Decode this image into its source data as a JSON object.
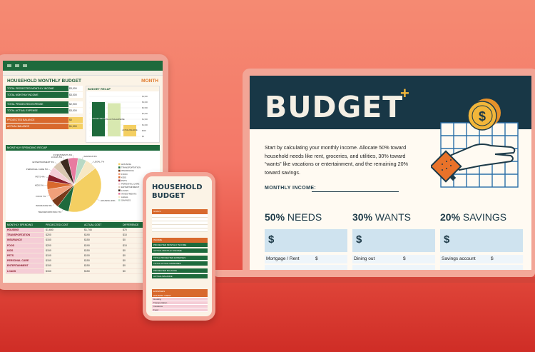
{
  "tablet": {
    "sheet_title": "HOUSEHOLD MONTHLY BUDGET",
    "sheet_month": "MONTH",
    "income_rows": [
      {
        "label": "TOTAL PROJECTED MONTHLY INCOME",
        "value": "$3,000",
        "style": "green",
        "val": "white"
      },
      {
        "label": "TOTAL MONTHLY INCOME",
        "value": "$3,000",
        "style": "green",
        "val": "white"
      },
      {
        "label": "TOTAL PROJECTED EXPENSE",
        "value": "$2,900",
        "style": "green",
        "val": "white",
        "gap": true
      },
      {
        "label": "TOTAL ACTUAL EXPENSE",
        "value": "$3,000",
        "style": "green",
        "val": "white"
      },
      {
        "label": "PROJECTED BALANCE",
        "value": "$0",
        "style": "orange",
        "val": "yellow",
        "gap": true
      },
      {
        "label": "ACTUAL BALANCE",
        "value": "$1,000",
        "style": "orange",
        "val": "yellow"
      }
    ],
    "recap_title": "BUDGET RECAP",
    "recap_bars": [
      {
        "label": "TOTAL PROJECTED INCOME",
        "value": 3000,
        "color": "#1e6a3c"
      },
      {
        "label": "TOTAL ACTUAL EXPENSE",
        "value": 2900,
        "color": "#d8e8b0"
      },
      {
        "label": "ACTUAL BALANCE",
        "value": 1000,
        "color": "#f4cf62"
      }
    ],
    "recap_yticks": [
      "$3,500",
      "$3,000",
      "$2,500",
      "$2,000",
      "$1,500",
      "$1,000",
      "$500",
      "$0"
    ],
    "spend_title": "MONTHLY SPENDING RECAP",
    "pie_slices": [
      {
        "label": "HOUSING 39%",
        "value": 39,
        "color": "#f4cf62"
      },
      {
        "label": "TRANSPORTATION 7%",
        "value": 7,
        "color": "#1e6a3c"
      },
      {
        "label": "INSURANCE 5%",
        "value": 5,
        "color": "#7a3a1a"
      },
      {
        "label": "FOOD 7%",
        "value": 7,
        "color": "#f1a07a"
      },
      {
        "label": "KIDS 5%",
        "value": 5,
        "color": "#d8692d"
      },
      {
        "label": "PETS 4%",
        "value": 4,
        "color": "#8a1f2c"
      },
      {
        "label": "PERSONAL CARE 5%",
        "value": 5,
        "color": "#f5cdd6"
      },
      {
        "label": "ENTERTAINMENT 5%",
        "value": 5,
        "color": "#d9c6b0"
      },
      {
        "label": "LOANS 5%",
        "value": 5,
        "color": "#3d2a20"
      },
      {
        "label": "INVESTMENTS 6%",
        "value": 6,
        "color": "#e87aa0"
      },
      {
        "label": "SAVINGS 5%",
        "value": 5,
        "color": "#b8d9c4"
      },
      {
        "label": "LEGAL 7%",
        "value": 7,
        "color": "#f7e8c4"
      }
    ],
    "legend": [
      "HOUSING",
      "TRANSPORTATION",
      "INSURANCE",
      "FOOD",
      "KIDS",
      "PETS",
      "PERSONAL CARE",
      "ENTERTAINMENT",
      "LOANS",
      "INVESTMENTS",
      "LEGAL",
      "SAVINGS"
    ],
    "table_headers": [
      "MONTHLY SPENDING",
      "PROJECTED COST",
      "ACTUAL COST",
      "DIFFERENCE"
    ],
    "table_rows": [
      [
        "HOUSING",
        "$1,650",
        "$1,745",
        "$70"
      ],
      [
        "TRANSPORTATION",
        "$200",
        "$190",
        "$10"
      ],
      [
        "INSURANCE",
        "$150",
        "$150",
        "$0"
      ],
      [
        "FOOD",
        "$200",
        "$190",
        "$10"
      ],
      [
        "KIDS",
        "$150",
        "$150",
        "$0"
      ],
      [
        "PETS",
        "$100",
        "$100",
        "$0"
      ],
      [
        "PERSONAL CARE",
        "$150",
        "$150",
        "$0"
      ],
      [
        "ENTERTAINMENT",
        "$150",
        "$150",
        "$0"
      ],
      [
        "LOANS",
        "$150",
        "$150",
        "$0"
      ]
    ]
  },
  "laptop": {
    "hero_title": "BUDGET",
    "hero_plus": "+",
    "intro": "Start by calculating your monthly income. Allocate 50% toward household needs like rent, groceries, and utilities, 30% toward “wants” like vacations or entertainment, and the remaining 20% toward savings.",
    "monthly_label": "MONTHLY INCOME:",
    "columns": [
      {
        "pct": "50%",
        "name": "NEEDS",
        "dollar": "$",
        "line_label": "Mortgage / Rent",
        "line_dollar": "$"
      },
      {
        "pct": "30%",
        "name": "WANTS",
        "dollar": "$",
        "line_label": "Dining out",
        "line_dollar": "$"
      },
      {
        "pct": "20%",
        "name": "SAVINGS",
        "dollar": "$",
        "line_label": "Savings account",
        "line_dollar": "$"
      }
    ],
    "coin_symbol": "$"
  },
  "phone": {
    "title_line1": "HOUSEHOLD",
    "title_line2": "BUDGET",
    "goals_label": "GOALS",
    "income_label": "INCOME",
    "income_rows": [
      "PROJECTED MONTHLY INCOME",
      "ACTUAL MONTHLY INCOME"
    ],
    "expense_rows": [
      "TOTAL PROJECTED EXPENSES",
      "TOTAL ACTUAL EXPENSES"
    ],
    "balance_rows": [
      "PROJECTED BALANCE",
      "ACTUAL BALANCE"
    ],
    "expenses_label": "EXPENSES",
    "expense_header": "HOUSING / RENT",
    "expense_items": [
      "Housing",
      "Transportation",
      "Insurance",
      "Food"
    ]
  }
}
